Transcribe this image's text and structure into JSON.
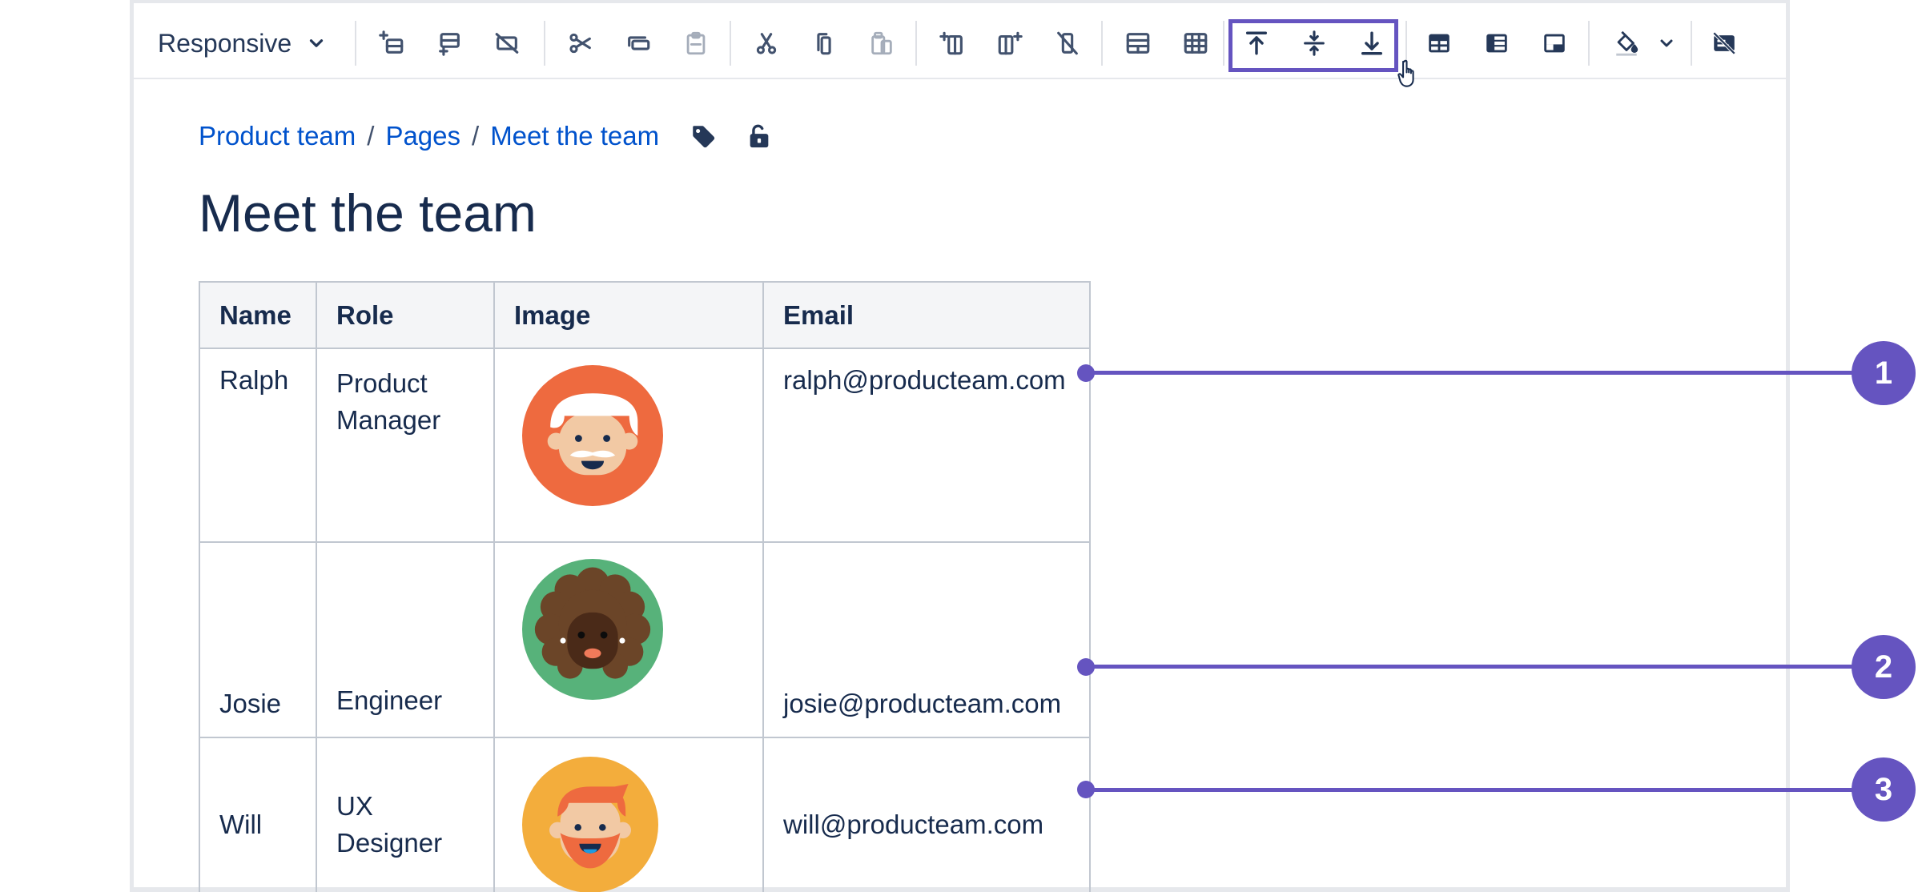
{
  "toolbar": {
    "layout_select": {
      "value": "Responsive",
      "icon": "chevron-down-icon"
    },
    "highlight_color": "#6554c0"
  },
  "breadcrumb": {
    "items": [
      "Product team",
      "Pages",
      "Meet the team"
    ],
    "separator": "/"
  },
  "page": {
    "title": "Meet the team"
  },
  "table": {
    "headers": [
      "Name",
      "Role",
      "Image",
      "Email"
    ],
    "rows": [
      {
        "name": "Ralph",
        "role_line1": "Product",
        "role_line2": "Manager",
        "avatar": "ralph-avatar",
        "email": "ralph@producteam.com",
        "align": "top"
      },
      {
        "name": "Josie",
        "role_line1": "Engineer",
        "role_line2": "",
        "avatar": "josie-avatar",
        "email": "josie@producteam.com",
        "align": "bottom"
      },
      {
        "name": "Will",
        "role_line1": "UX",
        "role_line2": "Designer",
        "avatar": "will-avatar",
        "email": "will@producteam.com",
        "align": "middle"
      }
    ]
  },
  "callouts": [
    "1",
    "2",
    "3"
  ],
  "colors": {
    "accent": "#6554c0",
    "link": "#0052cc",
    "text": "#172b4d",
    "header_bg": "#f4f5f7",
    "border": "#c1c7d0"
  }
}
